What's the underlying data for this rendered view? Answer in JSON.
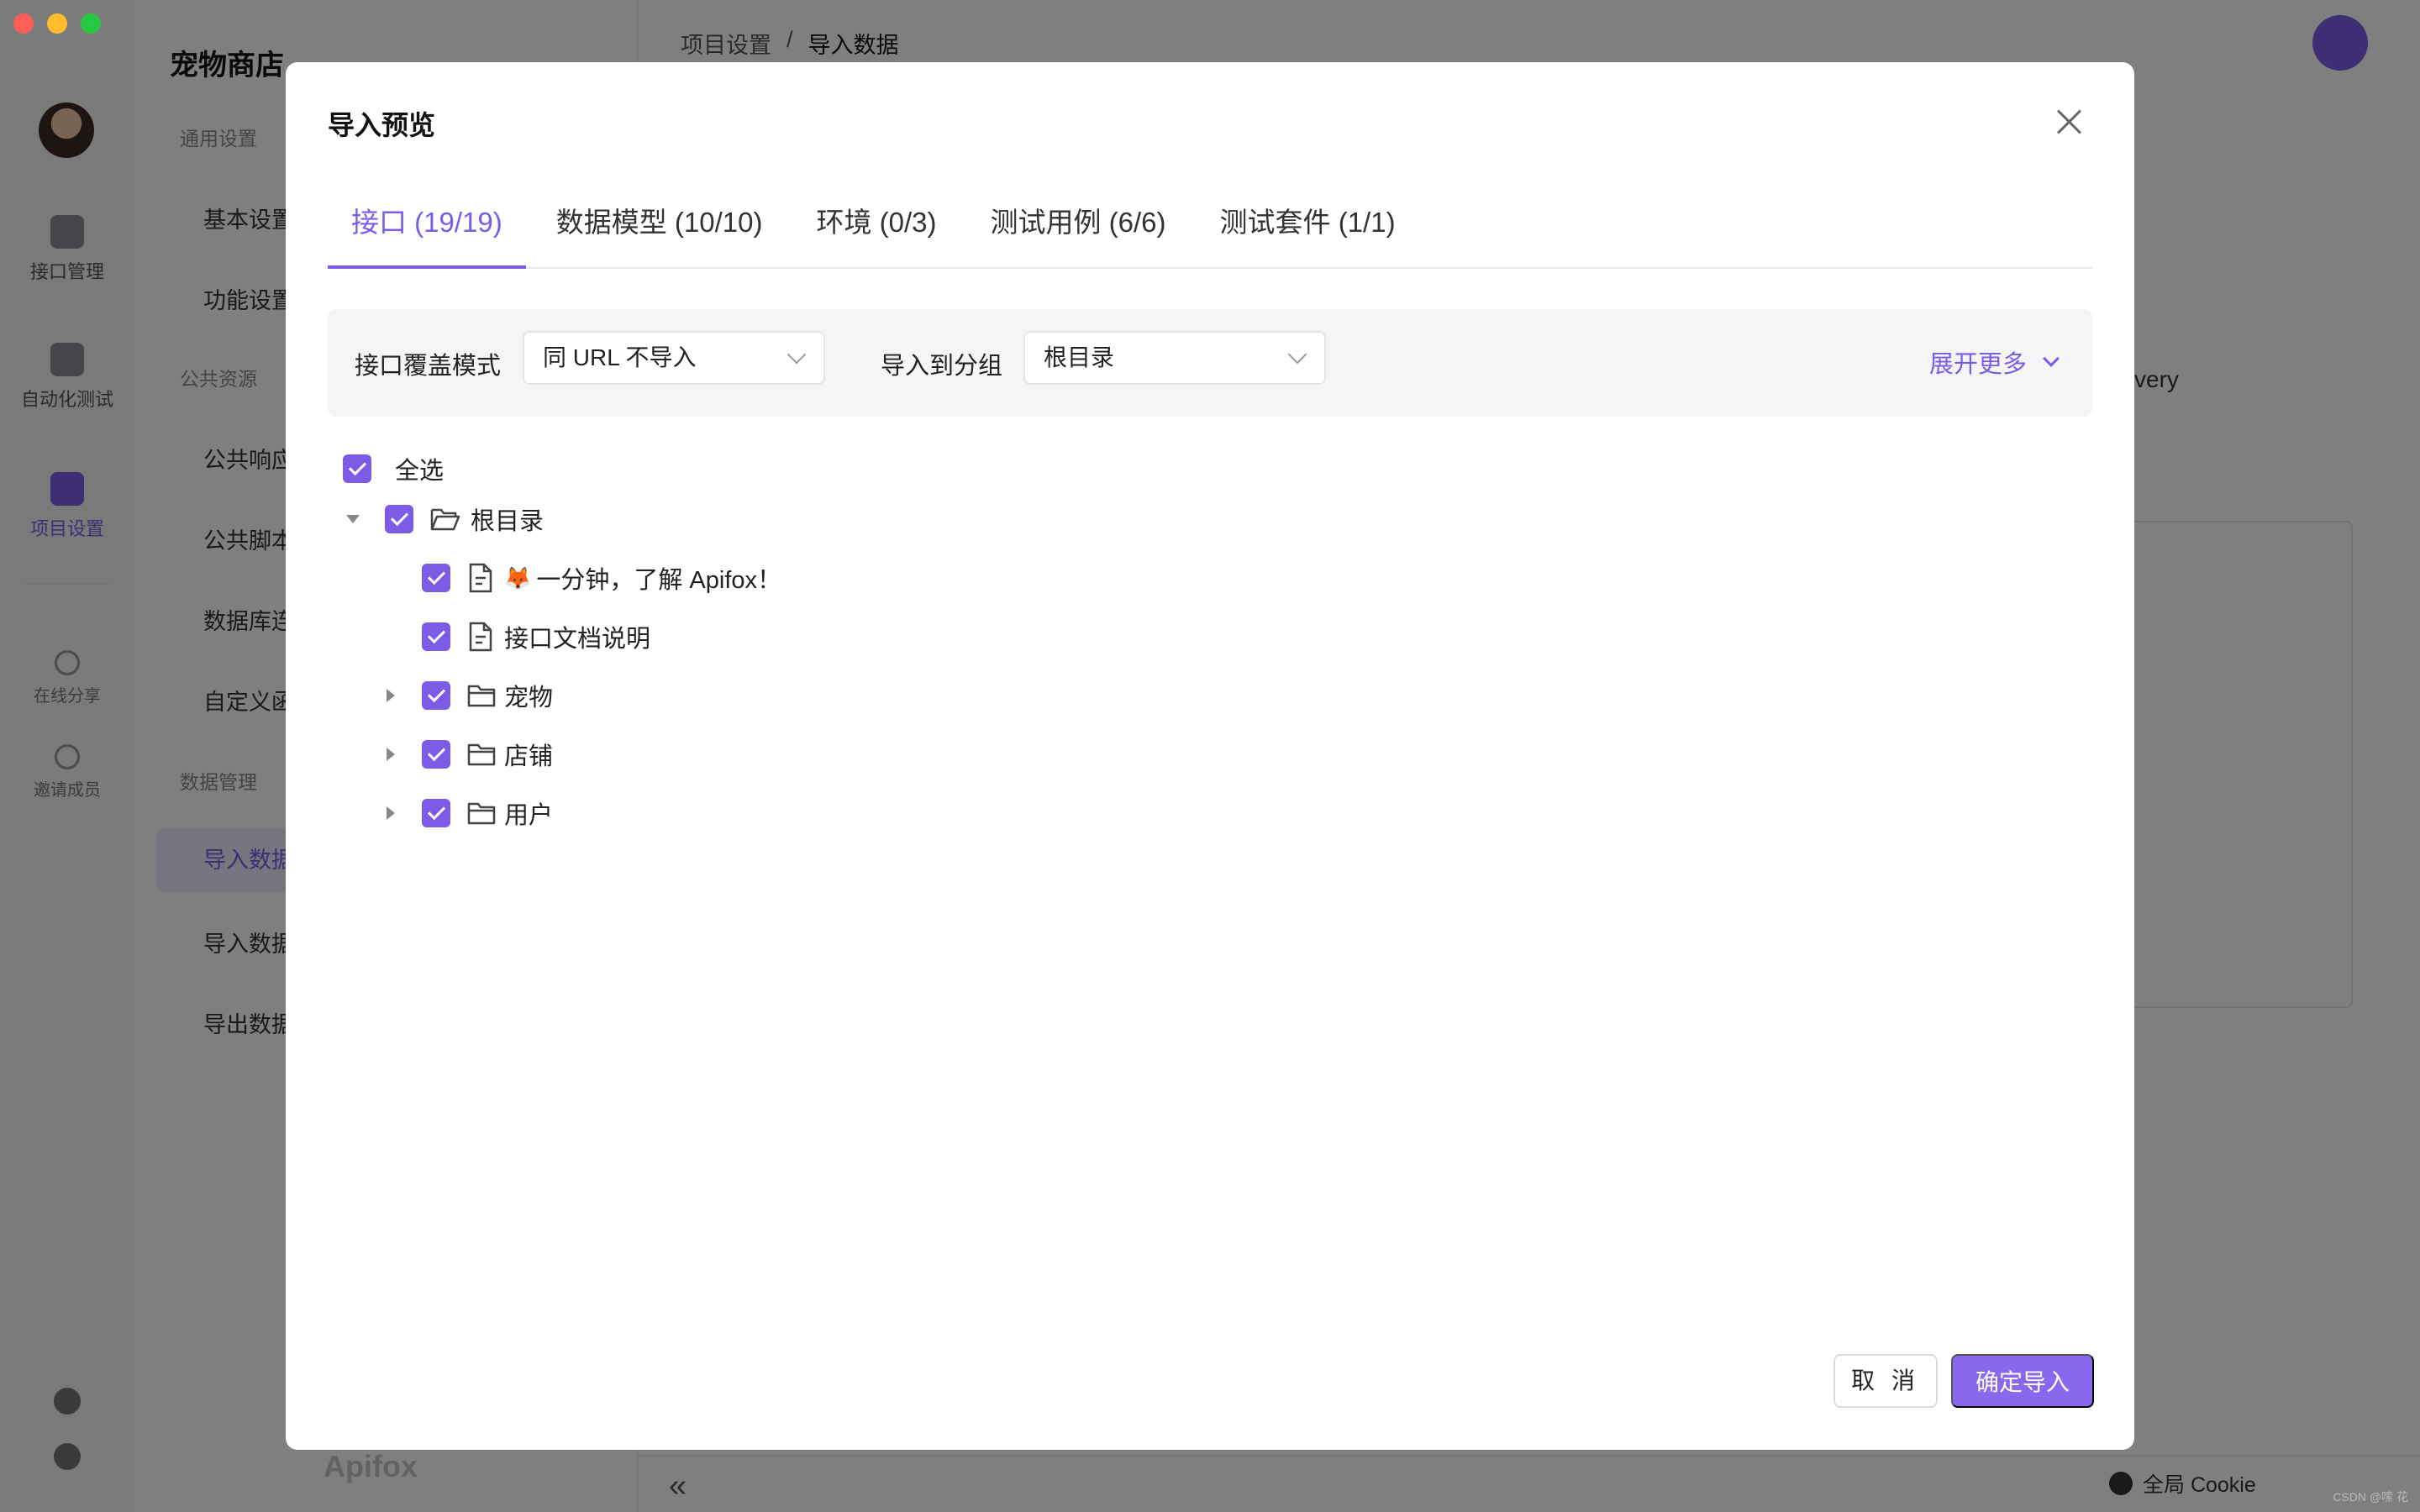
{
  "colors": {
    "accent": "#7c5ce6",
    "primary_button": "#8a68ee",
    "mask": "rgba(0,0,0,0.5)"
  },
  "rail": {
    "items": [
      {
        "label": "接口管理",
        "icon": "api-icon"
      },
      {
        "label": "自动化测试",
        "icon": "automation-icon"
      },
      {
        "label": "项目设置",
        "icon": "settings-doc-icon"
      }
    ],
    "small_items": [
      {
        "label": "在线分享",
        "icon": "share-icon"
      },
      {
        "label": "邀请成员",
        "icon": "add-user-icon"
      }
    ]
  },
  "nav": {
    "project_title": "宠物商店",
    "group_general": "通用设置",
    "basic_settings": "基本设置",
    "feature_settings": "功能设置",
    "group_resources": "公共资源",
    "public_response": "公共响应",
    "public_script": "公共脚本",
    "database": "数据库连",
    "custom": "自定义函",
    "group_data": "数据管理",
    "import_data": "导入数据",
    "import_data_2": "导入数据",
    "export_data": "导出数据"
  },
  "main": {
    "breadcrumb_parent": "项目设置",
    "breadcrumb_sep": "/",
    "breadcrumb_current": "导入数据",
    "bg_text": "very",
    "cookie_label": "全局 Cookie",
    "brand": "Apifox",
    "watermark": "CSDN @嗦 花"
  },
  "modal": {
    "title": "导入预览",
    "tabs": [
      {
        "label": "接口 (19/19)",
        "active": true
      },
      {
        "label": "数据模型 (10/10)",
        "active": false
      },
      {
        "label": "环境 (0/3)",
        "active": false
      },
      {
        "label": "测试用例 (6/6)",
        "active": false
      },
      {
        "label": "测试套件 (1/1)",
        "active": false
      }
    ],
    "filters": {
      "cover_mode_label": "接口覆盖模式",
      "cover_mode_value": "同 URL 不导入",
      "group_label": "导入到分组",
      "group_value": "根目录",
      "expand_more": "展开更多"
    },
    "select_all": "全选",
    "tree": {
      "root": "根目录",
      "items": [
        {
          "label": "一分钟，了解 Apifox！",
          "type": "doc",
          "emoji": "🦊"
        },
        {
          "label": "接口文档说明",
          "type": "doc"
        },
        {
          "label": "宠物",
          "type": "folder"
        },
        {
          "label": "店铺",
          "type": "folder"
        },
        {
          "label": "用户",
          "type": "folder"
        }
      ]
    },
    "cancel": "取 消",
    "confirm": "确定导入"
  }
}
